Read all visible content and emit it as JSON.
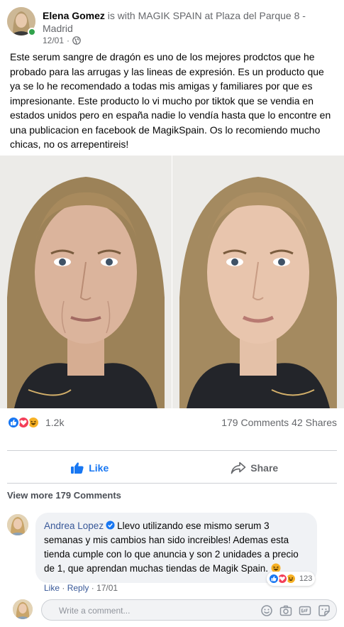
{
  "post": {
    "author": "Elena Gomez",
    "with_text": " is with ",
    "page_name": "MAGIK SPAIN",
    "at_text": " at ",
    "location": "Plaza del Parque 8 - Madrid",
    "date": "12/01",
    "separator": "·",
    "privacy_icon": "globe-icon",
    "body": "Este serum sangre de dragón es uno de los mejores prodctos que he probado para las arrugas y las lineas de expresión. Es un producto que ya se lo he recomendado a todas mis amigas y familiares por que es impresionante. Este producto lo vi mucho por tiktok que se vendia en estados unidos pero en españa nadie lo vendía hasta que lo encontre en una publicacion en facebook de MagikSpain. Os lo recomiendo mucho chicas, no os arrepentireis!"
  },
  "stats": {
    "reactions_count": "1.2k",
    "comments_count": "179 Comments",
    "shares_count": "42 Shares",
    "reaction_icons": [
      "like-icon",
      "love-icon",
      "haha-icon"
    ]
  },
  "actions": {
    "like_label": "Like",
    "share_label": "Share"
  },
  "comments_section": {
    "view_more": "View more 179 Comments",
    "comment": {
      "author": "Andrea Lopez",
      "text": "Llevo utilizando ese mismo serum 3 semanas y mis cambios han sido increibles! Ademas esta tienda cumple con lo que anuncia y son 2 unidades a precio de 1, que aprendan muchas tiendas de Magik Spain.",
      "reaction_count": "123",
      "like_label": "Like",
      "dot": "·",
      "reply_label": "Reply",
      "date": "17/01"
    },
    "composer_placeholder": "Write a comment..."
  },
  "colors": {
    "brand_blue": "#1877f2",
    "link_blue": "#385898",
    "love_red": "#f33e58",
    "haha_yellow": "#f7b125",
    "online_green": "#31a24c"
  }
}
